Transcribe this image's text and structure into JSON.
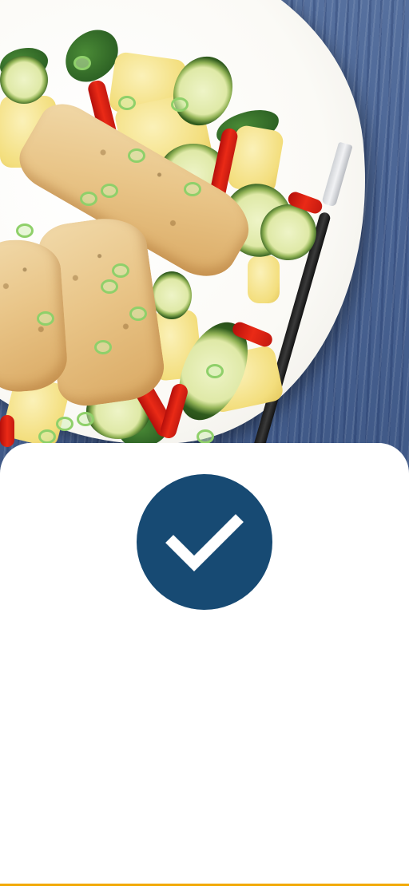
{
  "confirmation": {
    "icon": "checkmark-icon",
    "badge_color": "#174a73",
    "check_color": "#ffffff"
  },
  "hero": {
    "image": "chicken-vegetable-salad-photo"
  },
  "accent_color": "#f2a900"
}
